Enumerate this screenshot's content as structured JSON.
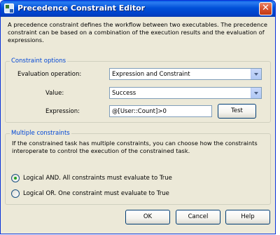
{
  "window": {
    "title": "Precedence Constraint Editor",
    "close_glyph": "✕"
  },
  "description": "A precedence constraint defines the workflow between two executables. The precedence constraint can be based on a combination of the execution results and the evaluation of expressions.",
  "constraint_options": {
    "legend": "Constraint options",
    "evaluation_label": "Evaluation operation:",
    "evaluation_value": "Expression and Constraint",
    "value_label": "Value:",
    "value_value": "Success",
    "expression_label": "Expression:",
    "expression_value": "@[User::Count]>0",
    "test_button": "Test"
  },
  "multiple_constraints": {
    "legend": "Multiple constraints",
    "description": "If the constrained task has multiple constraints, you can choose how the constraints interoperate to control the execution of the constrained task.",
    "options": [
      {
        "label": "Logical AND. All constraints must evaluate to True",
        "checked": true
      },
      {
        "label": "Logical OR. One constraint must evaluate to True",
        "checked": false
      }
    ]
  },
  "buttons": {
    "ok": "OK",
    "cancel": "Cancel",
    "help": "Help"
  },
  "colors": {
    "title_bar": "#0050d8",
    "group_legend": "#0046d5",
    "dialog_bg": "#ece9d8"
  }
}
